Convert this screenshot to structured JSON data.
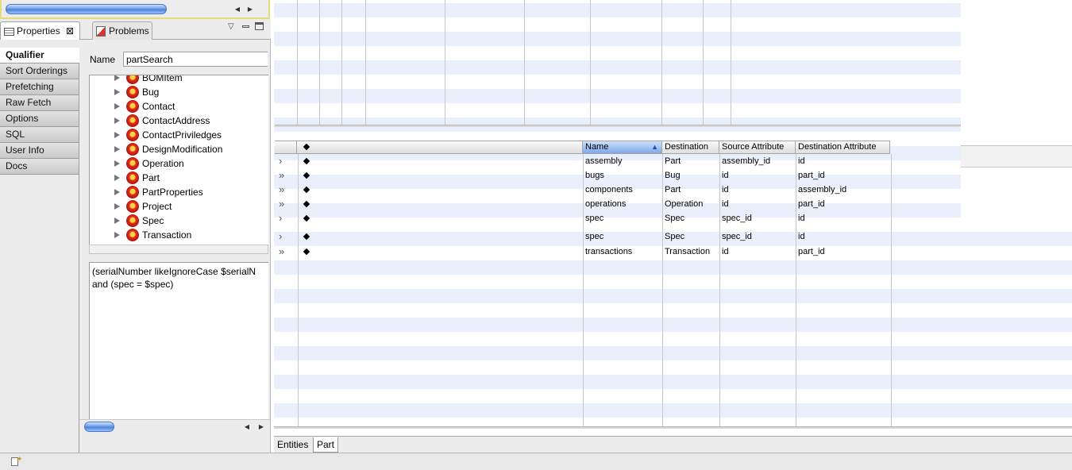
{
  "properties_panel": {
    "tabs": [
      {
        "label": "Properties",
        "icon": "properties-icon",
        "closable": true
      },
      {
        "label": "Problems",
        "icon": "problems-icon"
      }
    ],
    "categories": [
      "Qualifier",
      "Sort Orderings",
      "Prefetching",
      "Raw Fetch",
      "Options",
      "SQL",
      "User Info",
      "Docs"
    ],
    "selected_category": "Qualifier",
    "name_label": "Name",
    "name_value": "partSearch",
    "entities": [
      "BOMItem",
      "Bug",
      "Contact",
      "ContactAddress",
      "ContactPriviledges",
      "DesignModification",
      "Operation",
      "Part",
      "PartProperties",
      "Project",
      "Spec",
      "Transaction"
    ],
    "qualifier_line1": "(serialNumber likeIgnoreCase $serialN",
    "qualifier_line2": "and (spec = $spec)"
  },
  "relationships_table": {
    "headers": {
      "name": "Name",
      "destination": "Destination",
      "source_attribute": "Source Attribute",
      "destination_attribute": "Destination Attribute"
    },
    "sorted_column": "Name",
    "rows": [
      {
        "card": "›",
        "name": "assembly",
        "destination": "Part",
        "source_attr": "assembly_id",
        "dest_attr": "id"
      },
      {
        "card": "»",
        "name": "bugs",
        "destination": "Bug",
        "source_attr": "id",
        "dest_attr": "part_id"
      },
      {
        "card": "»",
        "name": "components",
        "destination": "Part",
        "source_attr": "id",
        "dest_attr": "assembly_id"
      },
      {
        "card": "»",
        "name": "operations",
        "destination": "Operation",
        "source_attr": "id",
        "dest_attr": "part_id"
      },
      {
        "card": "›",
        "name": "spec",
        "destination": "Spec",
        "source_attr": "spec_id",
        "dest_attr": "id"
      },
      {
        "card": "›",
        "name": "spec",
        "destination": "Spec",
        "source_attr": "spec_id",
        "dest_attr": "id"
      },
      {
        "card": "»",
        "name": "transactions",
        "destination": "Transaction",
        "source_attr": "id",
        "dest_attr": "part_id"
      }
    ]
  },
  "editor_tabs": [
    "Entities",
    "Part"
  ],
  "active_editor_tab": "Part",
  "colors": {
    "stripe": "#eaf0fb",
    "selection": "#7da7ea",
    "panel": "#ececec",
    "entity_icon": "#d8241a"
  }
}
